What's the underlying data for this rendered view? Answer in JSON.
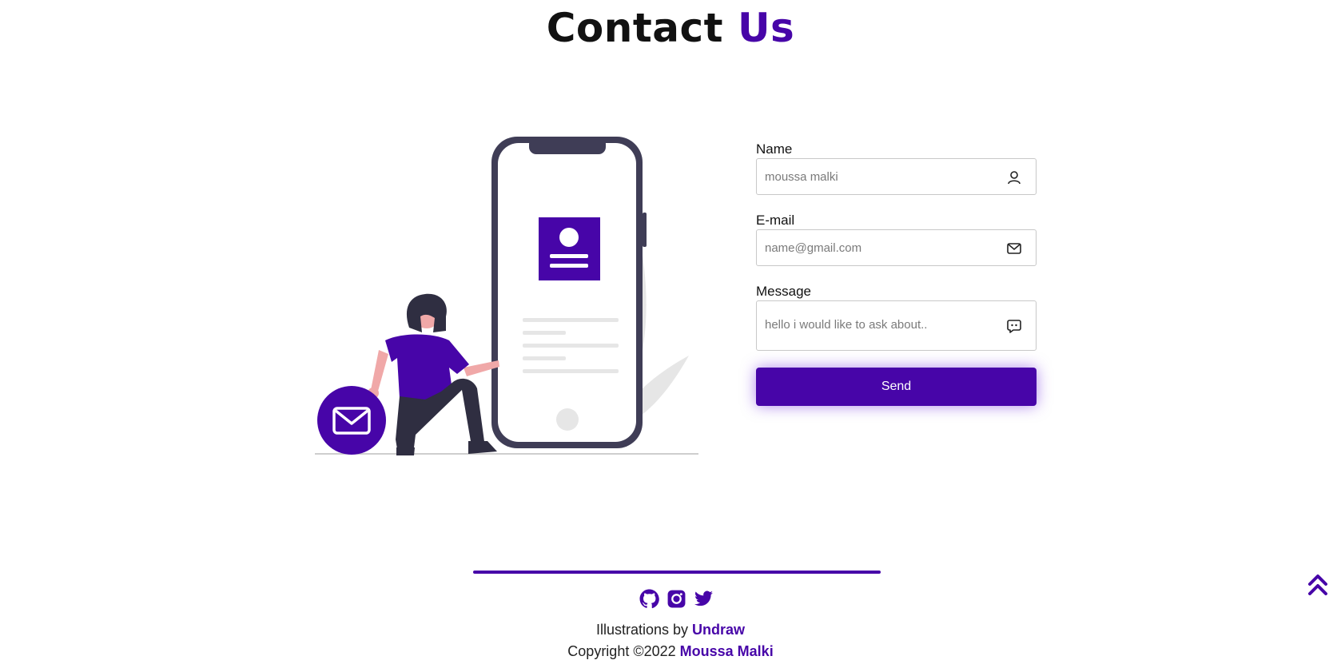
{
  "header": {
    "title_main": "Contact",
    "title_accent": "Us"
  },
  "form": {
    "name_label": "Name",
    "name_placeholder": "moussa malki",
    "email_label": "E-mail",
    "email_placeholder": "name@gmail.com",
    "message_label": "Message",
    "message_placeholder": "hello i would like to ask about..",
    "send_label": "Send"
  },
  "footer": {
    "illustrations_prefix": "Illustrations by",
    "illustrations_link": "Undraw",
    "copyright_prefix": "Copyright ©2022",
    "copyright_link": "Moussa Malki",
    "social_icons": [
      "github-icon",
      "instagram-icon",
      "twitter-icon"
    ]
  },
  "colors": {
    "accent": "#4705a8",
    "dark": "#3f3d56",
    "skin": "#f0a8a8",
    "light": "#e6e6e6"
  }
}
